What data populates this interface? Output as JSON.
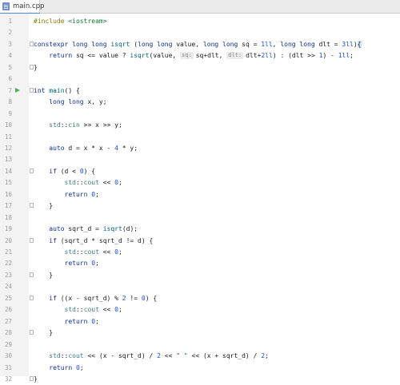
{
  "tab": {
    "filename": "main.cpp"
  },
  "lines": [
    {
      "n": "1",
      "segs": [
        [
          "pp",
          "#include "
        ],
        [
          "inc",
          "<iostream>"
        ]
      ]
    },
    {
      "n": "2",
      "segs": []
    },
    {
      "n": "3",
      "segs": [
        [
          "kw",
          "constexpr long long "
        ],
        [
          "fn",
          "isqrt"
        ],
        [
          "op",
          " ("
        ],
        [
          "kw",
          "long long "
        ],
        [
          "op",
          "value, "
        ],
        [
          "kw",
          "long long "
        ],
        [
          "op",
          "sq = "
        ],
        [
          "num",
          "1ll"
        ],
        [
          "op",
          ", "
        ],
        [
          "kw",
          "long long "
        ],
        [
          "op",
          "dlt = "
        ],
        [
          "num",
          "3ll"
        ],
        [
          "op",
          ")"
        ],
        [
          "hl",
          "{"
        ]
      ]
    },
    {
      "n": "4",
      "segs": [
        [
          "op",
          "    "
        ],
        [
          "kw",
          "return "
        ],
        [
          "op",
          "sq <= value ? "
        ],
        [
          "fn",
          "isqrt"
        ],
        [
          "op",
          "(value, "
        ],
        [
          "hint",
          "sq:"
        ],
        [
          "op",
          "sq+dlt, "
        ],
        [
          "hint",
          "dlt:"
        ],
        [
          "op",
          "dlt+"
        ],
        [
          "num",
          "2ll"
        ],
        [
          "op",
          ") : ("
        ],
        [
          "op",
          "dlt >> "
        ],
        [
          "num",
          "1"
        ],
        [
          "op",
          ") - "
        ],
        [
          "num",
          "1ll"
        ],
        [
          "op",
          ";"
        ]
      ]
    },
    {
      "n": "5",
      "segs": [
        [
          "op",
          "}"
        ]
      ]
    },
    {
      "n": "6",
      "segs": []
    },
    {
      "n": "7",
      "segs": [
        [
          "kw",
          "int "
        ],
        [
          "fn",
          "main"
        ],
        [
          "op",
          "() {"
        ]
      ]
    },
    {
      "n": "8",
      "segs": [
        [
          "op",
          "    "
        ],
        [
          "kw",
          "long long "
        ],
        [
          "op",
          "x, y;"
        ]
      ]
    },
    {
      "n": "9",
      "segs": []
    },
    {
      "n": "10",
      "segs": [
        [
          "op",
          "    "
        ],
        [
          "ns",
          "std"
        ],
        [
          "op",
          "::"
        ],
        [
          "ns",
          "cin"
        ],
        [
          "op",
          " >> x >> y;"
        ]
      ]
    },
    {
      "n": "11",
      "segs": []
    },
    {
      "n": "12",
      "segs": [
        [
          "op",
          "    "
        ],
        [
          "kw",
          "auto "
        ],
        [
          "op",
          "d = x * x - "
        ],
        [
          "num",
          "4"
        ],
        [
          "op",
          " * y;"
        ]
      ]
    },
    {
      "n": "13",
      "segs": []
    },
    {
      "n": "14",
      "segs": [
        [
          "op",
          "    "
        ],
        [
          "kw",
          "if "
        ],
        [
          "op",
          "(d < "
        ],
        [
          "num",
          "0"
        ],
        [
          "op",
          ") {"
        ]
      ]
    },
    {
      "n": "15",
      "segs": [
        [
          "op",
          "        "
        ],
        [
          "ns",
          "std"
        ],
        [
          "op",
          "::"
        ],
        [
          "ns",
          "cout"
        ],
        [
          "op",
          " << "
        ],
        [
          "num",
          "0"
        ],
        [
          "op",
          ";"
        ]
      ]
    },
    {
      "n": "16",
      "segs": [
        [
          "op",
          "        "
        ],
        [
          "kw",
          "return "
        ],
        [
          "num",
          "0"
        ],
        [
          "op",
          ";"
        ]
      ]
    },
    {
      "n": "17",
      "segs": [
        [
          "op",
          "    }"
        ]
      ]
    },
    {
      "n": "18",
      "segs": []
    },
    {
      "n": "19",
      "segs": [
        [
          "op",
          "    "
        ],
        [
          "kw",
          "auto "
        ],
        [
          "op",
          "sqrt_d = "
        ],
        [
          "fn",
          "isqrt"
        ],
        [
          "op",
          "(d);"
        ]
      ]
    },
    {
      "n": "20",
      "segs": [
        [
          "op",
          "    "
        ],
        [
          "kw",
          "if "
        ],
        [
          "op",
          "(sqrt_d * sqrt_d != d) {"
        ]
      ]
    },
    {
      "n": "21",
      "segs": [
        [
          "op",
          "        "
        ],
        [
          "ns",
          "std"
        ],
        [
          "op",
          "::"
        ],
        [
          "ns",
          "cout"
        ],
        [
          "op",
          " << "
        ],
        [
          "num",
          "0"
        ],
        [
          "op",
          ";"
        ]
      ]
    },
    {
      "n": "22",
      "segs": [
        [
          "op",
          "        "
        ],
        [
          "kw",
          "return "
        ],
        [
          "num",
          "0"
        ],
        [
          "op",
          ";"
        ]
      ]
    },
    {
      "n": "23",
      "segs": [
        [
          "op",
          "    }"
        ]
      ]
    },
    {
      "n": "24",
      "segs": []
    },
    {
      "n": "25",
      "segs": [
        [
          "op",
          "    "
        ],
        [
          "kw",
          "if "
        ],
        [
          "op",
          "((x - sqrt_d) % "
        ],
        [
          "num",
          "2"
        ],
        [
          "op",
          " != "
        ],
        [
          "num",
          "0"
        ],
        [
          "op",
          ") {"
        ]
      ]
    },
    {
      "n": "26",
      "segs": [
        [
          "op",
          "        "
        ],
        [
          "ns",
          "std"
        ],
        [
          "op",
          "::"
        ],
        [
          "ns",
          "cout"
        ],
        [
          "op",
          " << "
        ],
        [
          "num",
          "0"
        ],
        [
          "op",
          ";"
        ]
      ]
    },
    {
      "n": "27",
      "segs": [
        [
          "op",
          "        "
        ],
        [
          "kw",
          "return "
        ],
        [
          "num",
          "0"
        ],
        [
          "op",
          ";"
        ]
      ]
    },
    {
      "n": "28",
      "segs": [
        [
          "op",
          "    }"
        ]
      ]
    },
    {
      "n": "29",
      "segs": []
    },
    {
      "n": "30",
      "segs": [
        [
          "op",
          "    "
        ],
        [
          "ns",
          "std"
        ],
        [
          "op",
          "::"
        ],
        [
          "ns",
          "cout"
        ],
        [
          "op",
          " << (x - sqrt_d) / "
        ],
        [
          "num",
          "2"
        ],
        [
          "op",
          " << "
        ],
        [
          "str",
          "\" \""
        ],
        [
          "op",
          " << (x + sqrt_d) / "
        ],
        [
          "num",
          "2"
        ],
        [
          "op",
          ";"
        ]
      ]
    },
    {
      "n": "31",
      "segs": [
        [
          "op",
          "    "
        ],
        [
          "kw",
          "return "
        ],
        [
          "num",
          "0"
        ],
        [
          "op",
          ";"
        ]
      ]
    },
    {
      "n": "32",
      "segs": [
        [
          "op",
          "}"
        ]
      ]
    }
  ]
}
